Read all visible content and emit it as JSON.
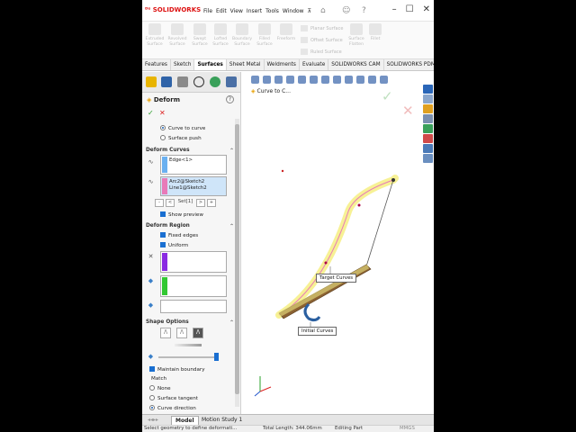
{
  "app": {
    "brand": "SOLIDWORKS"
  },
  "menu": [
    "File",
    "Edit",
    "View",
    "Insert",
    "Tools",
    "Window"
  ],
  "ribbon": {
    "buttons": [
      {
        "line1": "Extruded",
        "line2": "Surface"
      },
      {
        "line1": "Revolved",
        "line2": "Surface"
      },
      {
        "line1": "Swept",
        "line2": "Surface"
      },
      {
        "line1": "Lofted",
        "line2": "Surface"
      },
      {
        "line1": "Boundary",
        "line2": "Surface"
      },
      {
        "line1": "Filled",
        "line2": "Surface"
      },
      {
        "line1": "Freeform",
        "line2": ""
      }
    ],
    "planar_surface": "Planar Surface",
    "offset_surface": "Offset Surface",
    "ruled_surface": "Ruled Surface",
    "surface_flatten": {
      "line1": "Surface",
      "line2": "Flatten"
    },
    "fillet": {
      "line1": "Fillet",
      "line2": ""
    }
  },
  "tabs": [
    "Features",
    "Sketch",
    "Surfaces",
    "Sheet Metal",
    "Weldments",
    "Evaluate",
    "SOLIDWORKS CAM",
    "SOLIDWORKS PDM"
  ],
  "active_tab": "Surfaces",
  "property_manager": {
    "title": "Deform",
    "help": "?",
    "deform_type_options": [
      {
        "label": "Curve to curve",
        "selected": true
      },
      {
        "label": "Surface push",
        "selected": false
      }
    ],
    "deform_curves": {
      "header": "Deform Curves",
      "initial_curves": [
        "Edge<1>"
      ],
      "target_curves": [
        "Arc2@Sketch2",
        "Line1@Sketch2"
      ],
      "set_label": "Set[1]",
      "nav_buttons": [
        "-",
        "<",
        ">",
        "+"
      ],
      "show_preview": "Show preview"
    },
    "deform_region": {
      "header": "Deform Region",
      "fixed_edges": "Fixed edges",
      "uniform": "Uniform"
    },
    "shape_options": {
      "header": "Shape Options",
      "maintain_boundary": "Maintain boundary",
      "match_label": "Match",
      "match_options": [
        {
          "label": "None",
          "selected": false
        },
        {
          "label": "Surface tangent",
          "selected": false
        },
        {
          "label": "Curve direction",
          "selected": true
        }
      ]
    }
  },
  "viewport": {
    "breadcrumb": "Curve to C...",
    "callouts": {
      "target": "Target Curves",
      "initial": "Initial Curves"
    }
  },
  "bottom_tabs": [
    "Model",
    "Motion Study 1"
  ],
  "active_bottom_tab": "Model",
  "status": {
    "message": "Select geometry to define deformati...",
    "total_length": "Total Length: 344.06mm",
    "mode": "Editing Part",
    "units": "MMGS"
  },
  "colors": {
    "initial_curve_stripe": "#6ab0f0",
    "target_curve_stripe": "#e87ab8",
    "fixed_edges_stripe": "#8a2be2",
    "region_stripe": "#32c832",
    "highlight": "#f6f08a",
    "part_brown": "#8b6232",
    "brand_red": "#dd1111"
  }
}
